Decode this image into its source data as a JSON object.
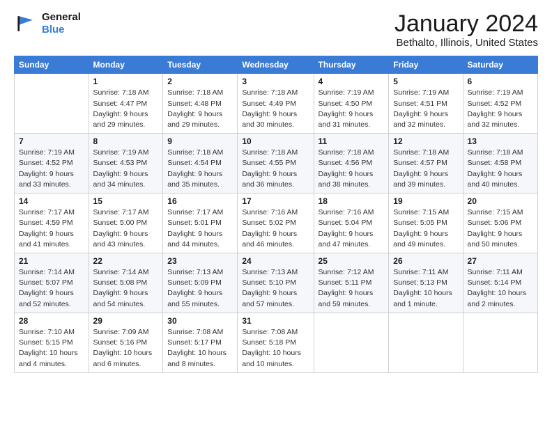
{
  "logo": {
    "line1": "General",
    "line2": "Blue"
  },
  "title": "January 2024",
  "subtitle": "Bethalto, Illinois, United States",
  "header_days": [
    "Sunday",
    "Monday",
    "Tuesday",
    "Wednesday",
    "Thursday",
    "Friday",
    "Saturday"
  ],
  "weeks": [
    [
      {
        "day": "",
        "info": ""
      },
      {
        "day": "1",
        "info": "Sunrise: 7:18 AM\nSunset: 4:47 PM\nDaylight: 9 hours\nand 29 minutes."
      },
      {
        "day": "2",
        "info": "Sunrise: 7:18 AM\nSunset: 4:48 PM\nDaylight: 9 hours\nand 29 minutes."
      },
      {
        "day": "3",
        "info": "Sunrise: 7:18 AM\nSunset: 4:49 PM\nDaylight: 9 hours\nand 30 minutes."
      },
      {
        "day": "4",
        "info": "Sunrise: 7:19 AM\nSunset: 4:50 PM\nDaylight: 9 hours\nand 31 minutes."
      },
      {
        "day": "5",
        "info": "Sunrise: 7:19 AM\nSunset: 4:51 PM\nDaylight: 9 hours\nand 32 minutes."
      },
      {
        "day": "6",
        "info": "Sunrise: 7:19 AM\nSunset: 4:52 PM\nDaylight: 9 hours\nand 32 minutes."
      }
    ],
    [
      {
        "day": "7",
        "info": "Sunrise: 7:19 AM\nSunset: 4:52 PM\nDaylight: 9 hours\nand 33 minutes."
      },
      {
        "day": "8",
        "info": "Sunrise: 7:19 AM\nSunset: 4:53 PM\nDaylight: 9 hours\nand 34 minutes."
      },
      {
        "day": "9",
        "info": "Sunrise: 7:18 AM\nSunset: 4:54 PM\nDaylight: 9 hours\nand 35 minutes."
      },
      {
        "day": "10",
        "info": "Sunrise: 7:18 AM\nSunset: 4:55 PM\nDaylight: 9 hours\nand 36 minutes."
      },
      {
        "day": "11",
        "info": "Sunrise: 7:18 AM\nSunset: 4:56 PM\nDaylight: 9 hours\nand 38 minutes."
      },
      {
        "day": "12",
        "info": "Sunrise: 7:18 AM\nSunset: 4:57 PM\nDaylight: 9 hours\nand 39 minutes."
      },
      {
        "day": "13",
        "info": "Sunrise: 7:18 AM\nSunset: 4:58 PM\nDaylight: 9 hours\nand 40 minutes."
      }
    ],
    [
      {
        "day": "14",
        "info": "Sunrise: 7:17 AM\nSunset: 4:59 PM\nDaylight: 9 hours\nand 41 minutes."
      },
      {
        "day": "15",
        "info": "Sunrise: 7:17 AM\nSunset: 5:00 PM\nDaylight: 9 hours\nand 43 minutes."
      },
      {
        "day": "16",
        "info": "Sunrise: 7:17 AM\nSunset: 5:01 PM\nDaylight: 9 hours\nand 44 minutes."
      },
      {
        "day": "17",
        "info": "Sunrise: 7:16 AM\nSunset: 5:02 PM\nDaylight: 9 hours\nand 46 minutes."
      },
      {
        "day": "18",
        "info": "Sunrise: 7:16 AM\nSunset: 5:04 PM\nDaylight: 9 hours\nand 47 minutes."
      },
      {
        "day": "19",
        "info": "Sunrise: 7:15 AM\nSunset: 5:05 PM\nDaylight: 9 hours\nand 49 minutes."
      },
      {
        "day": "20",
        "info": "Sunrise: 7:15 AM\nSunset: 5:06 PM\nDaylight: 9 hours\nand 50 minutes."
      }
    ],
    [
      {
        "day": "21",
        "info": "Sunrise: 7:14 AM\nSunset: 5:07 PM\nDaylight: 9 hours\nand 52 minutes."
      },
      {
        "day": "22",
        "info": "Sunrise: 7:14 AM\nSunset: 5:08 PM\nDaylight: 9 hours\nand 54 minutes."
      },
      {
        "day": "23",
        "info": "Sunrise: 7:13 AM\nSunset: 5:09 PM\nDaylight: 9 hours\nand 55 minutes."
      },
      {
        "day": "24",
        "info": "Sunrise: 7:13 AM\nSunset: 5:10 PM\nDaylight: 9 hours\nand 57 minutes."
      },
      {
        "day": "25",
        "info": "Sunrise: 7:12 AM\nSunset: 5:11 PM\nDaylight: 9 hours\nand 59 minutes."
      },
      {
        "day": "26",
        "info": "Sunrise: 7:11 AM\nSunset: 5:13 PM\nDaylight: 10 hours\nand 1 minute."
      },
      {
        "day": "27",
        "info": "Sunrise: 7:11 AM\nSunset: 5:14 PM\nDaylight: 10 hours\nand 2 minutes."
      }
    ],
    [
      {
        "day": "28",
        "info": "Sunrise: 7:10 AM\nSunset: 5:15 PM\nDaylight: 10 hours\nand 4 minutes."
      },
      {
        "day": "29",
        "info": "Sunrise: 7:09 AM\nSunset: 5:16 PM\nDaylight: 10 hours\nand 6 minutes."
      },
      {
        "day": "30",
        "info": "Sunrise: 7:08 AM\nSunset: 5:17 PM\nDaylight: 10 hours\nand 8 minutes."
      },
      {
        "day": "31",
        "info": "Sunrise: 7:08 AM\nSunset: 5:18 PM\nDaylight: 10 hours\nand 10 minutes."
      },
      {
        "day": "",
        "info": ""
      },
      {
        "day": "",
        "info": ""
      },
      {
        "day": "",
        "info": ""
      }
    ]
  ]
}
